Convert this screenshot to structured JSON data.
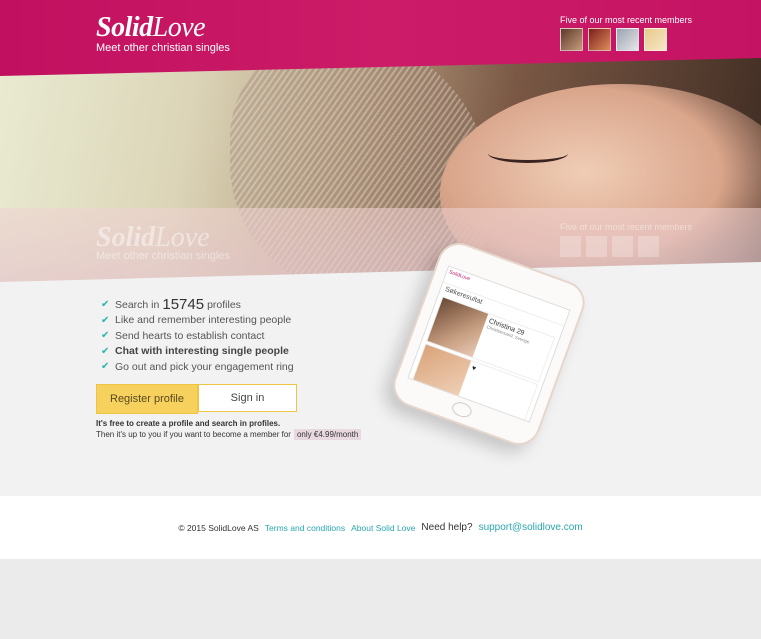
{
  "header": {
    "logo_solid": "Solid",
    "logo_love": "Love",
    "tagline": "Meet other christian singles",
    "recent_title": "Five of our most recent members"
  },
  "features": {
    "search_prefix": "Search in",
    "profile_count": "15745",
    "search_suffix": "profiles",
    "item2": "Like and remember interesting people",
    "item3": "Send hearts to establish contact",
    "item4": "Chat with interesting single people",
    "item5": "Go out and pick your engagement ring"
  },
  "buttons": {
    "register": "Register profile",
    "signin": "Sign in"
  },
  "note": {
    "free": "It's free to create a profile and search in profiles.",
    "member_prefix": "Then it's up to you if you want to become a member for",
    "price": "only €4.99/month"
  },
  "phone": {
    "brand": "SolidLove",
    "screen_title": "Søkeresultat",
    "profile_name": "Christina",
    "profile_age": "29",
    "profile_meta": "Christiansand, Sverige"
  },
  "footer": {
    "copyright": "© 2015 SolidLove AS",
    "terms": "Terms and conditions",
    "about": "About Solid Love",
    "help": "Need help?",
    "email": "support@solidlove.com"
  },
  "colors": {
    "brand": "#c51363",
    "accent_teal": "#2bb3b1",
    "button_yellow": "#f7d15e"
  }
}
